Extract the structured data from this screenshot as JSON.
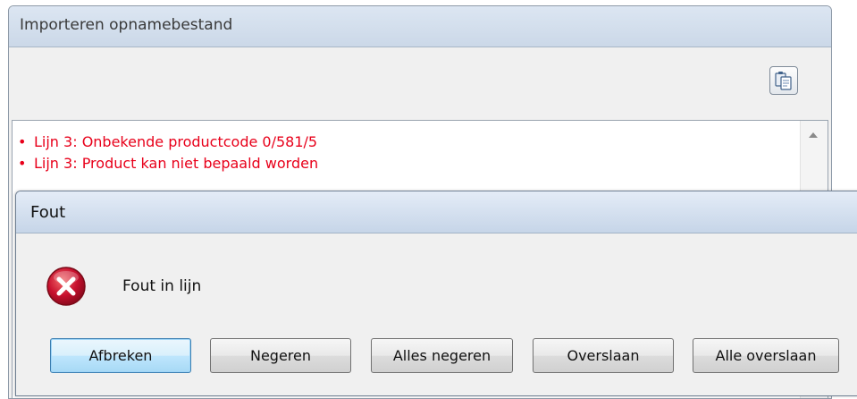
{
  "background_window": {
    "title": "Importeren opnamebestand",
    "toolbar": {
      "copy_icon": "copy-clipboard-icon"
    },
    "messages": [
      {
        "text": "Lijn 3: Onbekende productcode 0/581/5",
        "color": "#e8001a"
      },
      {
        "text": "Lijn 3: Product kan niet bepaald worden",
        "color": "#e8001a"
      }
    ]
  },
  "dialog": {
    "title": "Fout",
    "icon": "error-icon",
    "message": "Fout in lijn",
    "buttons": [
      {
        "id": "afbreken",
        "label": "Afbreken",
        "default": true
      },
      {
        "id": "negeren",
        "label": "Negeren",
        "default": false
      },
      {
        "id": "alles-negeren",
        "label": "Alles negeren",
        "default": false
      },
      {
        "id": "overslaan",
        "label": "Overslaan",
        "default": false
      },
      {
        "id": "alle-overslaan",
        "label": "Alle overslaan",
        "default": false
      }
    ]
  },
  "colors": {
    "error_text": "#e8001a",
    "error_icon": "#c8102e",
    "default_button_border": "#3c7fb1"
  }
}
